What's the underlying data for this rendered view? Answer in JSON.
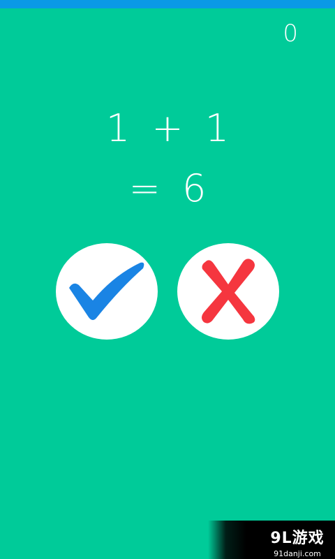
{
  "score": "0",
  "equation": {
    "line1": "1 + 1",
    "line2": "= 6"
  },
  "buttons": {
    "correct_icon": "checkmark-icon",
    "wrong_icon": "cross-icon"
  },
  "watermark": {
    "main": "9L游戏",
    "sub": "91danji.com"
  },
  "colors": {
    "background": "#00CB99",
    "status_bar": "#0A99E6",
    "check": "#1A84E4",
    "cross": "#F5363F",
    "button_bg": "#FFFFFF"
  }
}
